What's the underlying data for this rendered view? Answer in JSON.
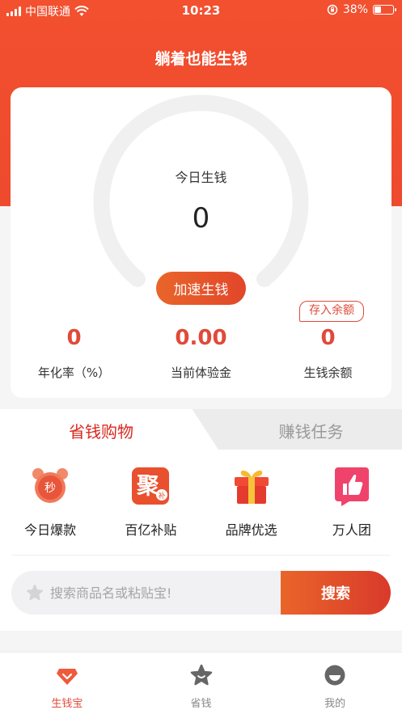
{
  "status_bar": {
    "carrier": "中国联通",
    "time": "10:23",
    "battery_percent": "38%",
    "battery_level": 0.38
  },
  "header": {
    "title": "躺着也能生钱"
  },
  "gauge": {
    "label": "今日生钱",
    "value": "0"
  },
  "speed_button_label": "加速生钱",
  "deposit_tag_label": "存入余额",
  "stats": [
    {
      "value": "0",
      "label": "年化率（%）"
    },
    {
      "value": "0.00",
      "label": "当前体验金"
    },
    {
      "value": "0",
      "label": "生钱余额"
    }
  ],
  "tabs": {
    "active": "省钱购物",
    "inactive": "赚钱任务"
  },
  "shop_items": [
    {
      "label": "今日爆款",
      "icon": "alarm-clock-icon"
    },
    {
      "label": "百亿补贴",
      "icon": "ju-subsidy-icon"
    },
    {
      "label": "品牌优选",
      "icon": "gift-box-icon"
    },
    {
      "label": "万人团",
      "icon": "thumbs-up-icon"
    }
  ],
  "search": {
    "placeholder": "搜索商品名或粘贴宝!",
    "button_label": "搜索"
  },
  "tabbar": [
    {
      "label": "生钱宝",
      "icon": "gem-icon",
      "active": true
    },
    {
      "label": "省钱",
      "icon": "star-icon",
      "active": false
    },
    {
      "label": "我的",
      "icon": "profile-icon",
      "active": false
    }
  ],
  "colors": {
    "brand_red": "#ee4a2e",
    "accent_red": "#e04a3a",
    "tab_active_text": "#d9291f"
  }
}
